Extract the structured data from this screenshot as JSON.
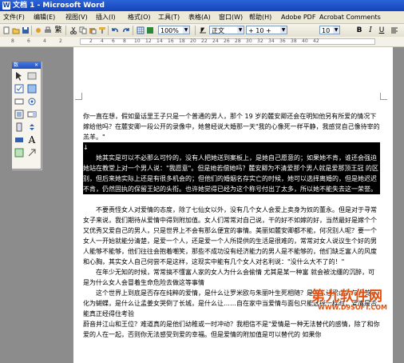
{
  "window": {
    "title": "文档 1 - Microsoft Word"
  },
  "menu": [
    "文件(F)",
    "编辑(E)",
    "视图(V)",
    "插入(I)",
    "格式(O)",
    "工具(T)",
    "表格(A)",
    "窗口(W)",
    "帮助(H)",
    "Adobe PDF",
    "Acrobat Comments"
  ],
  "toolbar": {
    "standard_font": "繁",
    "zoom": "100%",
    "style": "正文",
    "style_font": "+ 10 +",
    "font_size": "10",
    "bold": "B",
    "italic": "I",
    "underline": "U"
  },
  "ruler": {
    "numbers": [
      "8",
      "6",
      "4",
      "2",
      "2",
      "4",
      "6",
      "8",
      "10",
      "12",
      "14",
      "16",
      "18",
      "20",
      "22",
      "24",
      "26",
      "28",
      "30",
      "32",
      "34",
      "36",
      "38",
      "40",
      "42"
    ]
  },
  "palette": {
    "title": "数"
  },
  "document": {
    "p1": "你一直在想，假如童话里王子只是一个普通的男人，那个 19 岁的麓安卿还会在明知他另有所爱的情况下嫁给他吗？在麓安卿一段公开的录像中，她曾经说大婚那一天\"我的心像死一样平静，我感觉自己像待宰的羔羊。\"",
    "sel_mark": "↓",
    "sel": "她其实是可以不必那么可怜的，没有人把她送到案板上，是她自己愿意的；如果她不肯，谁还会强迫她站在教堂上对一个男人说：\"我愿意\"。但是她若偿她吗？麓安卿为不清爱那个男人就是爱那顶王冠 的区别，但后来她实际上还是有很多机会的；但他们的婚姻名存实亡的时候，她可以选择离婚的，但是她迟迟不肯，仍然固执的保留王妃的头衔。也许她觉得已经为这个称号付出了太多，所以她不能失去这一荣誉。",
    "p2": "不要责怪女人对爱情的态度，除了七仙女以外，没有几个女人会爱上卖身为奴的董永。但是对于寻常女子来说，我们期待从爱情中得到附加值。女人们常常对自己说，干的好不如嫁的好，当然最好是嫁个个又优秀又爱自己的男人，只是世界上不会有那么便宜的事情。美丽如麓安卿都不能，何况别人呢？要一个女人一开始就能分清楚，是爱一个人，还是爱一个人所提供的生活是很难的，常常对女人说议生个好的男人能够不能够，他们往往会抱着嘲笑，那些不成功没有经济能力的男人是不能够的，他们缺乏富人的风度和心胸，其实女人自己何尝不是这样，这现实中能有几个女人对名利说：\"没什么大不了的！\"",
    "p3": "在年少无知的时候，常常搞不懂富人家的女人为什么会偷情 尤其是某一种富 就会被沈缰的沉醉，可是为什么女人会冒着生命危险去做这等事情",
    "p4": "这个世界上到底是否存在纯粹的爱情，是什么让罗米欧与朱丽叶生死相随？是什么让梁山伯与祝英台化为蝴蝶，是什么让孟姜女哭倒了长城，是什么让……自在家中当爱情与面包只能选择一样时，爱情是否能真正经得住考验",
    "p5": "蔚音并江山和王位？难道真的是他们幼稚或一时冲动？我相信不是\"爱情是一种无法替代的感情，除了和你爱的人在一起，否则你无法感受到爱的幸福。但是爱情的附加值是可以替代的 如果你"
  },
  "watermark": {
    "main": "第九软件网",
    "sub": "WWW.D9SOFT.COM"
  }
}
